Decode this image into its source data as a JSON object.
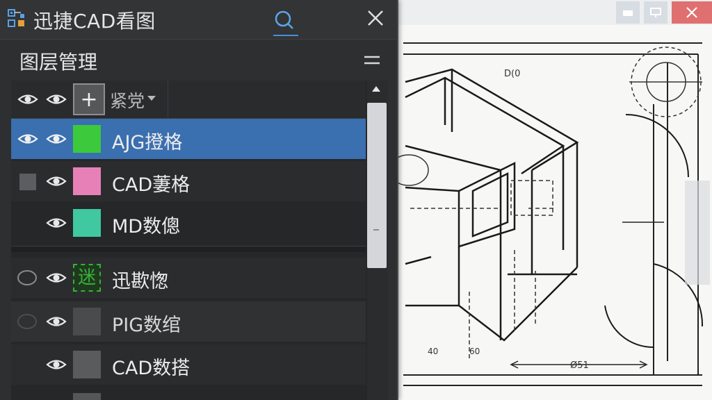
{
  "app": {
    "title": "迅捷CAD看图"
  },
  "window": {
    "close_symbol": "✕"
  },
  "layer_panel": {
    "title": "图层管理",
    "toolbar": {
      "add_symbol": "+",
      "sort_label": "紧党"
    },
    "layers": [
      {
        "label": "AJG撜格",
        "color": "#3cc93c",
        "selected": true,
        "state": "visible"
      },
      {
        "label": "CAD萋格",
        "color": "#e880b8",
        "selected": false,
        "state": "locked"
      },
      {
        "label": "MD数傯",
        "color": "#40c8a0",
        "selected": false,
        "state": "visible"
      },
      {
        "label": "迅歁愡",
        "color": "#3ab03a",
        "selected": false,
        "state": "off",
        "swatch_text": "迷"
      },
      {
        "label": "PIG数绾",
        "color": "#4a4b4d",
        "selected": false,
        "state": "off"
      },
      {
        "label": "CAD数搭",
        "color": "#5a5b5d",
        "selected": false,
        "state": "visible"
      }
    ]
  },
  "drawing": {
    "label_top": "D(0",
    "dim_labels": [
      "40",
      "60",
      "Ø51"
    ]
  },
  "icons": {
    "app": "app-logo-icon",
    "search": "search-icon",
    "close": "close-icon",
    "menu": "menu-icon",
    "eye": "eye-icon",
    "checkbox": "checkbox-icon",
    "radio": "radio-icon",
    "minimize": "minimize-icon",
    "restore": "restore-icon"
  },
  "colors": {
    "panel_bg": "#2e2f31",
    "selected": "#3a6fb0",
    "accent": "#4a8fd8"
  }
}
